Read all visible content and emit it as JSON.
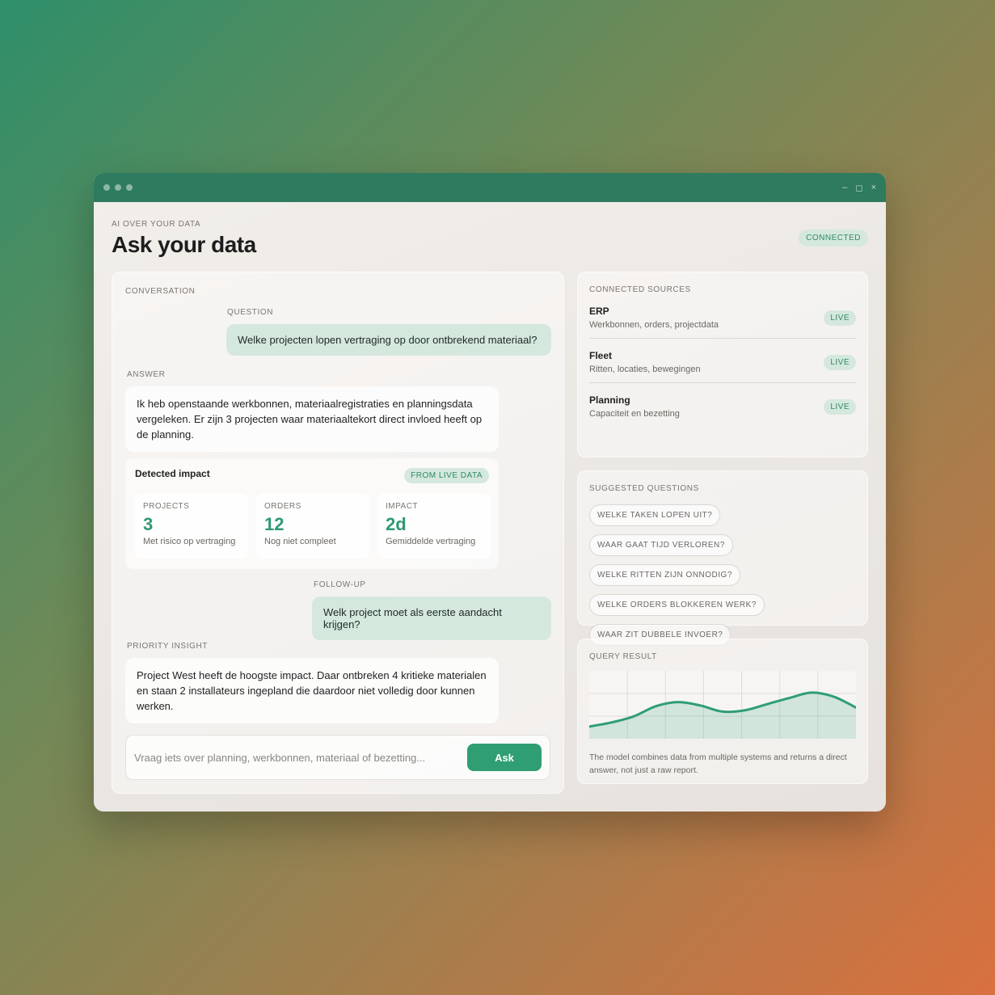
{
  "window": {
    "controls": [
      "–",
      "◻",
      "×"
    ]
  },
  "header": {
    "eyebrow": "AI OVER YOUR DATA",
    "title": "Ask your data",
    "status": "CONNECTED"
  },
  "conversation": {
    "section_label": "CONVERSATION",
    "question_label": "QUESTION",
    "question": "Welke projecten lopen vertraging op door ontbrekend materiaal?",
    "answer_label": "ANSWER",
    "answer": "Ik heb openstaande werkbonnen, materiaalregistraties en planningsdata vergeleken. Er zijn 3 projecten waar materiaaltekort direct invloed heeft op de planning.",
    "impact": {
      "title": "Detected impact",
      "badge": "FROM LIVE DATA",
      "stats": [
        {
          "label": "PROJECTS",
          "value": "3",
          "sub": "Met risico op vertraging"
        },
        {
          "label": "ORDERS",
          "value": "12",
          "sub": "Nog niet compleet"
        },
        {
          "label": "IMPACT",
          "value": "2d",
          "sub": "Gemiddelde vertraging"
        }
      ]
    },
    "followup_label": "FOLLOW-UP",
    "followup": "Welk project moet als eerste aandacht krijgen?",
    "insight_label": "PRIORITY INSIGHT",
    "insight": "Project West heeft de hoogste impact. Daar ontbreken 4 kritieke materialen en staan 2 installateurs ingepland die daardoor niet volledig door kunnen werken.",
    "input_placeholder": "Vraag iets over planning, werkbonnen, materiaal of bezetting...",
    "ask_label": "Ask"
  },
  "sources": {
    "section_label": "CONNECTED SOURCES",
    "items": [
      {
        "name": "ERP",
        "desc": "Werkbonnen, orders, projectdata",
        "status": "LIVE"
      },
      {
        "name": "Fleet",
        "desc": "Ritten, locaties, bewegingen",
        "status": "LIVE"
      },
      {
        "name": "Planning",
        "desc": "Capaciteit en bezetting",
        "status": "LIVE"
      }
    ]
  },
  "suggestions": {
    "section_label": "SUGGESTED QUESTIONS",
    "items": [
      "WELKE TAKEN LOPEN UIT?",
      "WAAR GAAT TIJD VERLOREN?",
      "WELKE RITTEN ZIJN ONNODIG?",
      "WELKE ORDERS BLOKKEREN WERK?",
      "WAAR ZIT DUBBELE INVOER?"
    ]
  },
  "query_result": {
    "section_label": "QUERY RESULT",
    "note": "The model combines data from multiple systems and returns a direct answer, not just a raw report."
  },
  "colors": {
    "accent": "#2f9e73",
    "titlebar": "#2e7b5f",
    "badge_bg": "#d5e8de"
  },
  "chart_data": {
    "type": "area",
    "title": "",
    "xlabel": "",
    "ylabel": "",
    "x": [
      0,
      1,
      2,
      3,
      4,
      5,
      6,
      7,
      8,
      9,
      10,
      11,
      12
    ],
    "values": [
      18,
      24,
      33,
      48,
      54,
      49,
      40,
      42,
      51,
      60,
      68,
      62,
      46
    ],
    "ylim": [
      0,
      100
    ],
    "grid": true
  }
}
